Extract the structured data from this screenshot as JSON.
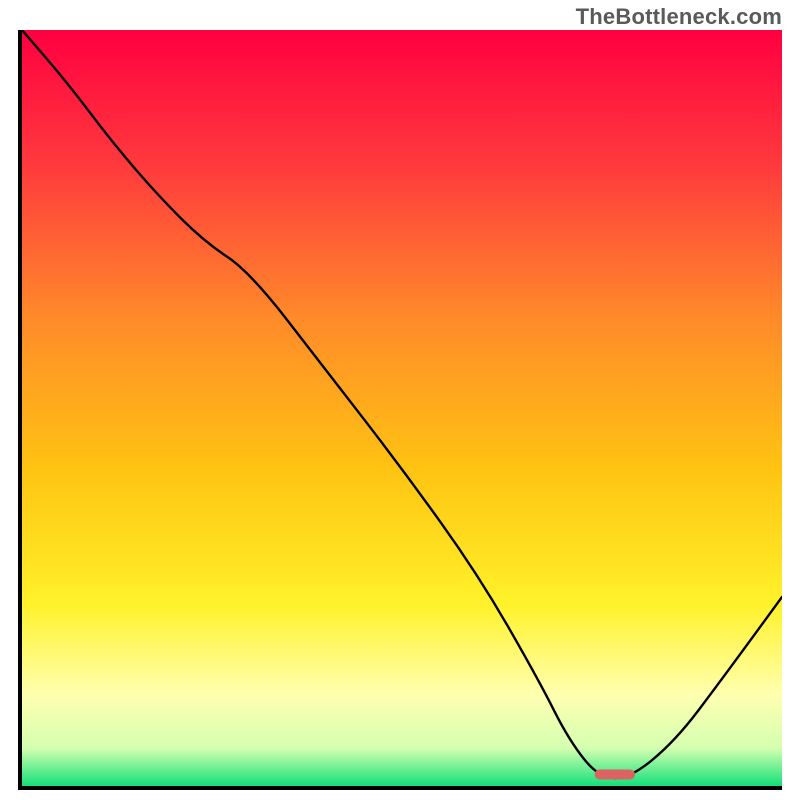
{
  "watermark": "TheBottleneck.com",
  "gradient": {
    "stops": [
      {
        "offset": "0%",
        "color": "#ff0040"
      },
      {
        "offset": "18%",
        "color": "#ff3a3d"
      },
      {
        "offset": "38%",
        "color": "#ff8a2a"
      },
      {
        "offset": "58%",
        "color": "#ffc312"
      },
      {
        "offset": "76%",
        "color": "#fff22a"
      },
      {
        "offset": "88%",
        "color": "#ffffb0"
      },
      {
        "offset": "95%",
        "color": "#d4ffb0"
      },
      {
        "offset": "100%",
        "color": "#14e07a"
      }
    ]
  },
  "chart_data": {
    "type": "line",
    "title": "",
    "xlabel": "",
    "ylabel": "",
    "xlim": [
      0,
      100
    ],
    "ylim": [
      0,
      100
    ],
    "x": [
      0,
      6,
      12,
      18,
      24,
      30,
      40,
      50,
      60,
      68,
      72,
      76,
      80,
      86,
      92,
      100
    ],
    "values": [
      100,
      93,
      85,
      78,
      72,
      68,
      55,
      42,
      28,
      14,
      6,
      1,
      1,
      6,
      14,
      25
    ],
    "optimal_range": {
      "x_start": 76,
      "x_end": 80,
      "value": 1
    },
    "annotations": []
  }
}
